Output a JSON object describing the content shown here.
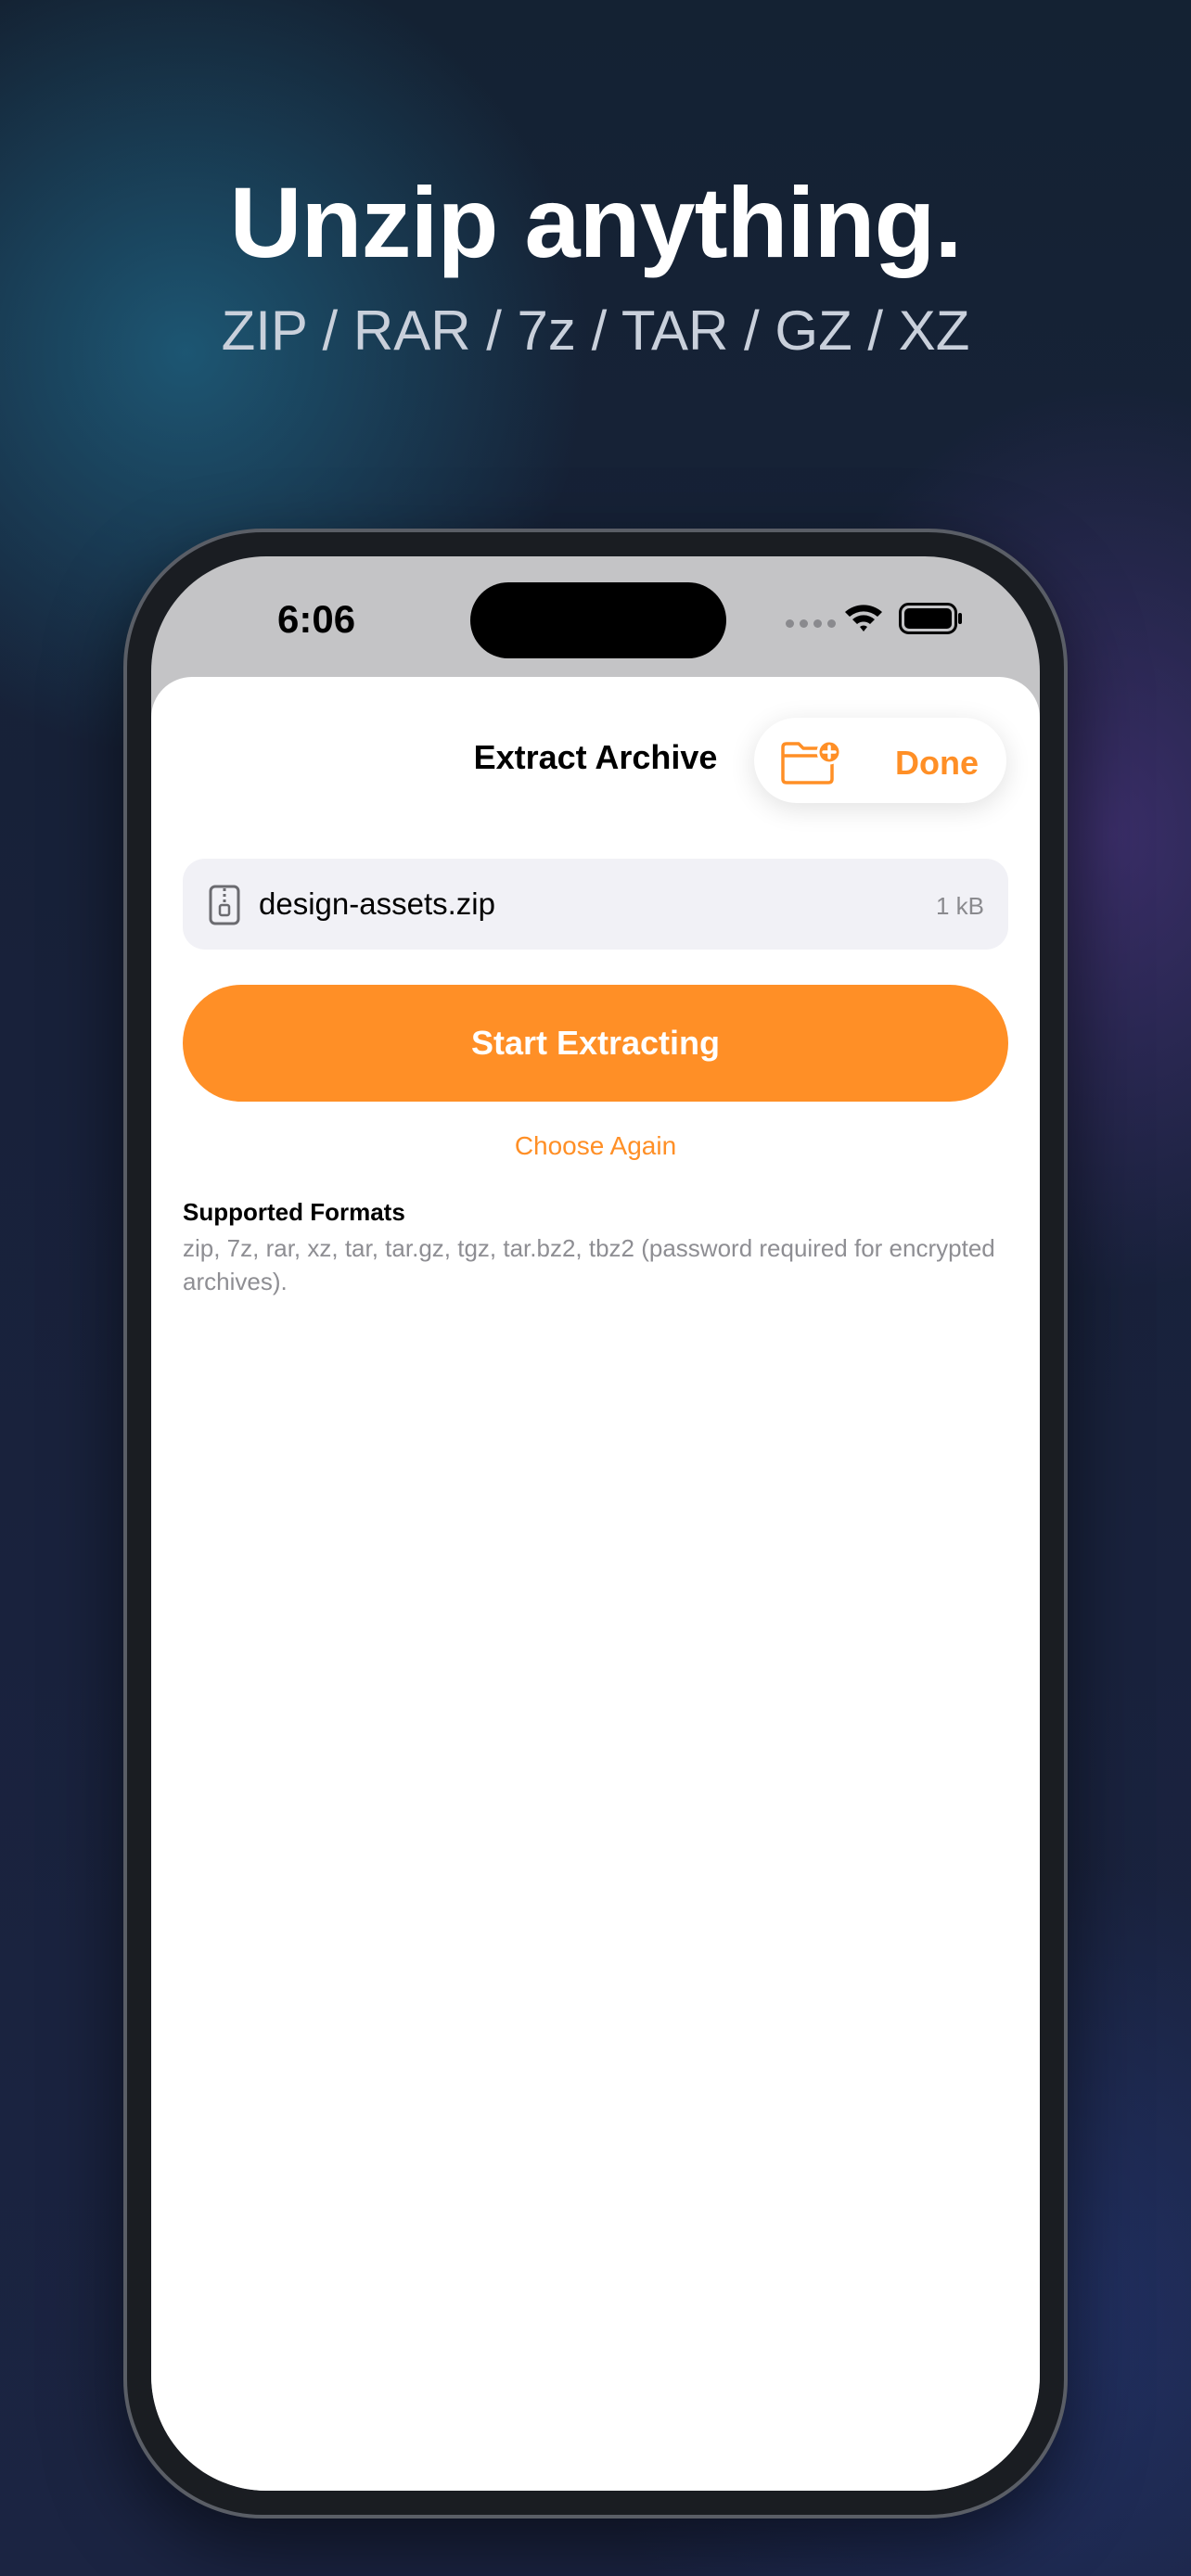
{
  "marketing": {
    "headline": "Unzip anything.",
    "subheadline": "ZIP / RAR / 7z / TAR / GZ / XZ"
  },
  "status_bar": {
    "time": "6:06",
    "icons": [
      "signal-dots-icon",
      "wifi-icon",
      "battery-icon"
    ]
  },
  "nav": {
    "title": "Extract Archive",
    "new_folder_icon": "folder-add-icon",
    "done_label": "Done"
  },
  "file": {
    "icon": "zip-file-icon",
    "name": "design-assets.zip",
    "size": "1 kB"
  },
  "actions": {
    "start_label": "Start Extracting",
    "choose_again_label": "Choose Again"
  },
  "supported_formats": {
    "title": "Supported Formats",
    "description": "zip, 7z, rar, xz, tar, tar.gz, tgz, tar.bz2, tbz2 (password required for encrypted archives)."
  },
  "colors": {
    "accent": "#ff8f26",
    "sheet_background": "#ffffff",
    "file_row_background": "#f1f1f6",
    "secondary_text": "#8e8e93"
  }
}
